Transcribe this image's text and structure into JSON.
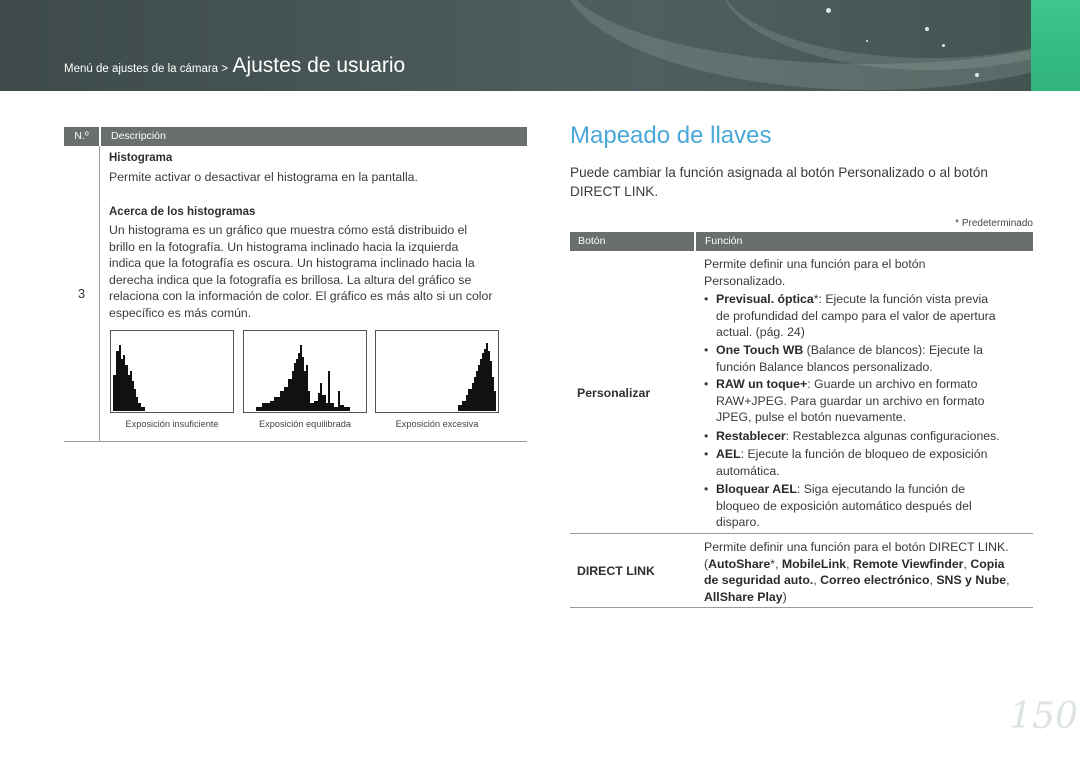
{
  "header": {
    "breadcrumb_parent": "Menú de ajustes de la cámara >",
    "breadcrumb_current": "Ajustes de usuario"
  },
  "left_table": {
    "col_no": "N.º",
    "col_desc": "Descripción",
    "row_no": "3",
    "histogram_title": "Histograma",
    "histogram_text": "Permite activar o desactivar el histograma en la pantalla.",
    "about_title": "Acerca de los histogramas",
    "about_lines": [
      "Un histograma es un gráfico que muestra cómo está distribuido el",
      "brillo en la fotografía. Un histograma inclinado hacia la izquierda",
      "indica que la fotografía es oscura. Un histograma inclinado hacia la",
      "derecha indica que la fotografía es brillosa. La altura del gráfico se",
      "relaciona con la información de color. El gráfico es más alto si un color",
      "específico es más común."
    ],
    "captions": [
      "Exposición insuficiente",
      "Exposición equilibrada",
      "Exposición excesiva"
    ]
  },
  "right": {
    "title": "Mapeado de llaves",
    "intro_line1": "Puede cambiar la función asignada al botón Personalizado o al botón",
    "intro_line2": "DIRECT LINK.",
    "default_note": "* Predeterminado",
    "col_button": "Botón",
    "col_function": "Función",
    "personalizar": {
      "key": "Personalizar",
      "intro_l1": "Permite definir una función para el botón",
      "intro_l2": "Personalizado.",
      "b1_bold": "Previsual. óptica",
      "b1_l1": "*: Ejecute la función vista previa",
      "b1_l2": "de profundidad del campo para el valor de apertura",
      "b1_l3": "actual. (pág. 24)",
      "b2_bold": "One Touch WB",
      "b2_l1": " (Balance de blancos): Ejecute la",
      "b2_l2": "función Balance blancos personalizado.",
      "b3_bold": "RAW un toque+",
      "b3_l1": ": Guarde un archivo en formato",
      "b3_l2": "RAW+JPEG. Para guardar un archivo en formato",
      "b3_l3": "JPEG, pulse el botón nuevamente.",
      "b4_bold": "Restablecer",
      "b4_l1": ": Restablezca algunas configuraciones.",
      "b5_bold": "AEL",
      "b5_l1": ": Ejecute la función de bloqueo de exposición",
      "b5_l2": "automática.",
      "b6_bold": "Bloquear AEL",
      "b6_l1": ": Siga ejecutando la función de",
      "b6_l2": "bloqueo de exposición automático después del",
      "b6_l3": "disparo."
    },
    "direct_link": {
      "key": "DIRECT LINK",
      "l1": "Permite definir una función para el botón DIRECT LINK.",
      "paren_open": "(",
      "autoshare": "AutoShare",
      "star_sep": "*, ",
      "mobilelink": "MobileLink",
      "sep": ", ",
      "remote": "Remote Viewfinder",
      "copia": "Copia",
      "l3_part1": "de seguridad auto.",
      "correo": "Correo electrónico",
      "sns": "SNS y Nube",
      "comma": ",",
      "allshare": "AllShare Play",
      "paren_close": ")"
    }
  },
  "page_number": "150"
}
